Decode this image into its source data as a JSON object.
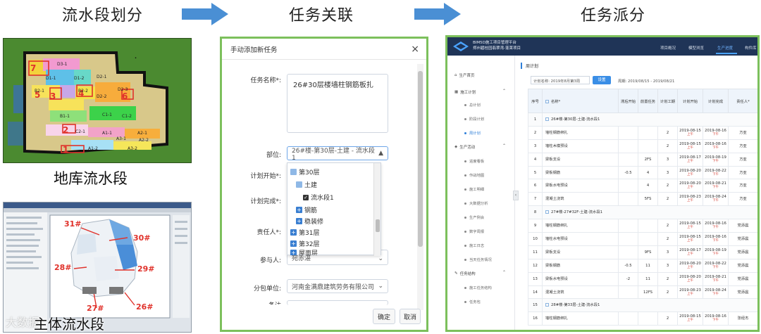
{
  "steps": [
    {
      "title": "流水段划分"
    },
    {
      "title": "任务关联"
    },
    {
      "title": "任务派分"
    }
  ],
  "left_panel": {
    "site_plan_label": "地库流水段",
    "bim_label": "主体流水段",
    "watermark": "大数据",
    "site_zones": [
      {
        "label": "D3-1"
      },
      {
        "label": "D1-1"
      },
      {
        "label": "D1-2"
      },
      {
        "label": "D2-1"
      },
      {
        "label": "B2-1"
      },
      {
        "label": "B2-2"
      },
      {
        "label": "D2-3"
      },
      {
        "label": "D2-2"
      },
      {
        "label": "B1-1"
      },
      {
        "label": "C1-1"
      },
      {
        "label": "C1-2"
      },
      {
        "label": "C2-1"
      },
      {
        "label": "A1-1"
      },
      {
        "label": "A2-1"
      },
      {
        "label": "A2-2"
      },
      {
        "label": "A3-1"
      },
      {
        "label": "A1-2"
      },
      {
        "label": "A3-2"
      }
    ],
    "site_numbers": [
      "7",
      "5",
      "3",
      "6",
      "2",
      "4",
      "1"
    ],
    "building_tags": [
      "31#",
      "30#",
      "28#",
      "29#",
      "27#",
      "26#"
    ]
  },
  "dialog": {
    "title": "手动添加新任务",
    "close_glyph": "×",
    "task_name_label": "任务名称*:",
    "task_name_value": "26#30层楼墙柱钢筋板扎",
    "location_label": "部位:",
    "location_value": "26#楼-第30层-土建 - 流水段1",
    "plan_start_label": "计划开始*:",
    "plan_end_label": "计划完成*:",
    "owner_label": "责任人*:",
    "participants_label": "参与人:",
    "participants_value": "宛赤湛",
    "subcontractor_label": "分包单位:",
    "subcontractor_value": "河南金满鼎建筑劳务有限公司",
    "cut_label": "备注",
    "dropdown_items": [
      {
        "label": "第30层",
        "kind": "minus"
      },
      {
        "label": "土建",
        "kind": "minus"
      },
      {
        "label": "流水段1",
        "kind": "check"
      },
      {
        "label": "钢筋",
        "kind": "plus"
      },
      {
        "label": "稳装修",
        "kind": "plus"
      },
      {
        "label": "第31层",
        "kind": "plus"
      },
      {
        "label": "第32层",
        "kind": "plus"
      },
      {
        "label": "屋面层",
        "kind": "plus"
      }
    ],
    "confirm_label": "确定",
    "cancel_label": "取消"
  },
  "app": {
    "title_line1": "BIM5D施工项目管理平台",
    "title_line2": "郑州碧桂园翡翠湾-蓬莱项目",
    "top_nav": [
      "项目概况",
      "模型浏览",
      "生产进度",
      "构件库"
    ],
    "active_nav": "生产进度",
    "sidebar": {
      "home": "生产首页",
      "plan_group": "施工计划",
      "plan_items": [
        "总计划",
        "阶段计划",
        "周计划"
      ],
      "active_plan": "周计划",
      "activity_group": "生产活动",
      "activity_items": [
        "进度看板",
        "作战地图",
        "施工明细",
        "大数据分析",
        "生产例会",
        "数字周报",
        "施工日志",
        "当天任务情况"
      ],
      "task_group": "任务结构",
      "task_items": [
        "施工任务结构",
        "任务包"
      ],
      "collapse_glyph": "‹"
    },
    "crumb": "周计划",
    "plan_select_label": "计划名称: 2019年8月第3周",
    "plan_button": "设置",
    "period": "周期: 2019/08/15 - 2019/08/21",
    "columns": [
      "序号",
      "名称*",
      "滞后开始",
      "前置任务",
      "计划工期",
      "计划开始",
      "计划完成",
      "责任人*"
    ],
    "rows": [
      {
        "no": "1",
        "group": true,
        "name": "26#楼-第30层-土建-流水段1"
      },
      {
        "no": "2",
        "name": "墙柱钢筋绑扎",
        "lag": "",
        "pre": "",
        "dur": "2",
        "start": "2019-08-15",
        "start_sub": "上午",
        "end": "2019-08-16",
        "end_sub": "下午",
        "owner": "方亚"
      },
      {
        "no": "3",
        "name": "墙柱木模预设",
        "lag": "",
        "pre": "",
        "dur": "2",
        "start": "2019-08-15",
        "start_sub": "上午",
        "end": "2019-08-16",
        "end_sub": "下午",
        "owner": "方亚"
      },
      {
        "no": "4",
        "name": "梁板支设",
        "lag": "",
        "pre": "2FS",
        "dur": "3",
        "start": "2019-08-17",
        "start_sub": "上午",
        "end": "2019-08-19",
        "end_sub": "下午",
        "owner": "方亚"
      },
      {
        "no": "5",
        "name": "梁板钢筋",
        "lag": "-0.5",
        "pre": "4",
        "dur": "3",
        "start": "2019-08-20",
        "start_sub": "上午",
        "end": "2019-08-22",
        "end_sub": "下午",
        "owner": "方亚"
      },
      {
        "no": "6",
        "name": "梁板水电预设",
        "lag": "",
        "pre": "4",
        "dur": "2",
        "start": "2019-08-20",
        "start_sub": "上午",
        "end": "2019-08-21",
        "end_sub": "下午",
        "owner": "方亚"
      },
      {
        "no": "7",
        "name": "混凝土浇筑",
        "lag": "",
        "pre": "5FS",
        "dur": "2",
        "start": "2019-08-23",
        "start_sub": "上午",
        "end": "2019-08-24",
        "end_sub": "下午",
        "owner": "方亚"
      },
      {
        "no": "8",
        "group": true,
        "name": "27#楼-27#32F-土建-流水段1"
      },
      {
        "no": "9",
        "name": "墙柱钢筋绑扎",
        "lag": "",
        "pre": "",
        "dur": "2",
        "start": "2019-08-15",
        "start_sub": "上午",
        "end": "2019-08-16",
        "end_sub": "下午",
        "owner": "党添晨"
      },
      {
        "no": "10",
        "name": "墙柱水电预设",
        "lag": "",
        "pre": "",
        "dur": "2",
        "start": "2019-08-15",
        "start_sub": "上午",
        "end": "2019-08-16",
        "end_sub": "下午",
        "owner": "党添晨"
      },
      {
        "no": "11",
        "name": "梁板支设",
        "lag": "",
        "pre": "9FS",
        "dur": "3",
        "start": "2019-08-17",
        "start_sub": "上午",
        "end": "2019-08-19",
        "end_sub": "下午",
        "owner": "党添晨"
      },
      {
        "no": "12",
        "name": "梁板钢筋",
        "lag": "-0.5",
        "pre": "11",
        "dur": "3",
        "start": "2019-08-20",
        "start_sub": "上午",
        "end": "2019-08-22",
        "end_sub": "下午",
        "owner": "党添晨"
      },
      {
        "no": "13",
        "name": "梁板水电预设",
        "lag": "-2",
        "pre": "11",
        "dur": "2",
        "start": "2019-08-20",
        "start_sub": "上午",
        "end": "2019-08-21",
        "end_sub": "下午",
        "owner": "党添晨"
      },
      {
        "no": "14",
        "name": "混凝土浇筑",
        "lag": "",
        "pre": "12FS",
        "dur": "2",
        "start": "2019-08-23",
        "start_sub": "上午",
        "end": "2019-08-24",
        "end_sub": "下午",
        "owner": "党添晨"
      },
      {
        "no": "15",
        "group": true,
        "name": "28#楼-第33层-土建-流水段1"
      },
      {
        "no": "16",
        "name": "墙柱钢筋绑扎",
        "lag": "",
        "pre": "",
        "dur": "2",
        "start": "2019-08-15",
        "start_sub": "上午",
        "end": "2019-08-16",
        "end_sub": "下午",
        "owner": "张经杰"
      }
    ]
  },
  "colors": {
    "arrow_blue": "#4a8fd4",
    "frame_green": "#7cc05c",
    "app_header": "#1f3457",
    "accent_blue": "#3a8ee6"
  }
}
